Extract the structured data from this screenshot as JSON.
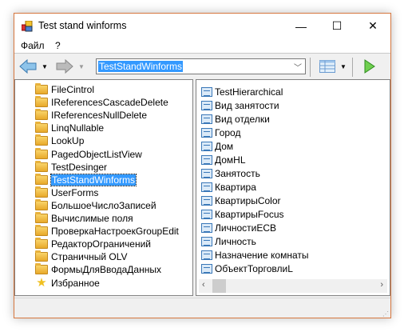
{
  "window": {
    "title": "Test stand winforms",
    "minimize": "—",
    "maximize": "☐",
    "close": "✕"
  },
  "menu": [
    "Файл",
    "?"
  ],
  "toolbar": {
    "address": "TestStandWinforms"
  },
  "tree": [
    "FileCintrol",
    "IReferencesCascadeDelete",
    "IReferencesNullDelete",
    "LinqNullable",
    "LookUp",
    "PagedObjectListView",
    "TestDesinger",
    "TestStandWinforms",
    "UserForms",
    "БольшоеЧислоЗаписей",
    "Вычислимые поля",
    "ПроверкаНастроекGroupEdit",
    "РедакторОграничений",
    "Страничный OLV",
    "ФормыДляВводаДанных",
    "Избранное"
  ],
  "selected_tree_index": 7,
  "list": [
    "TestHierarchical",
    "Вид занятости",
    "Вид отделки",
    "Город",
    "Дом",
    "ДомHL",
    "Занятость",
    "Квартира",
    "КвартирыColor",
    "КвартирыFocus",
    "ЛичностиECB",
    "Личность",
    "Назначение комнаты",
    "ОбъектТорговлиL"
  ]
}
